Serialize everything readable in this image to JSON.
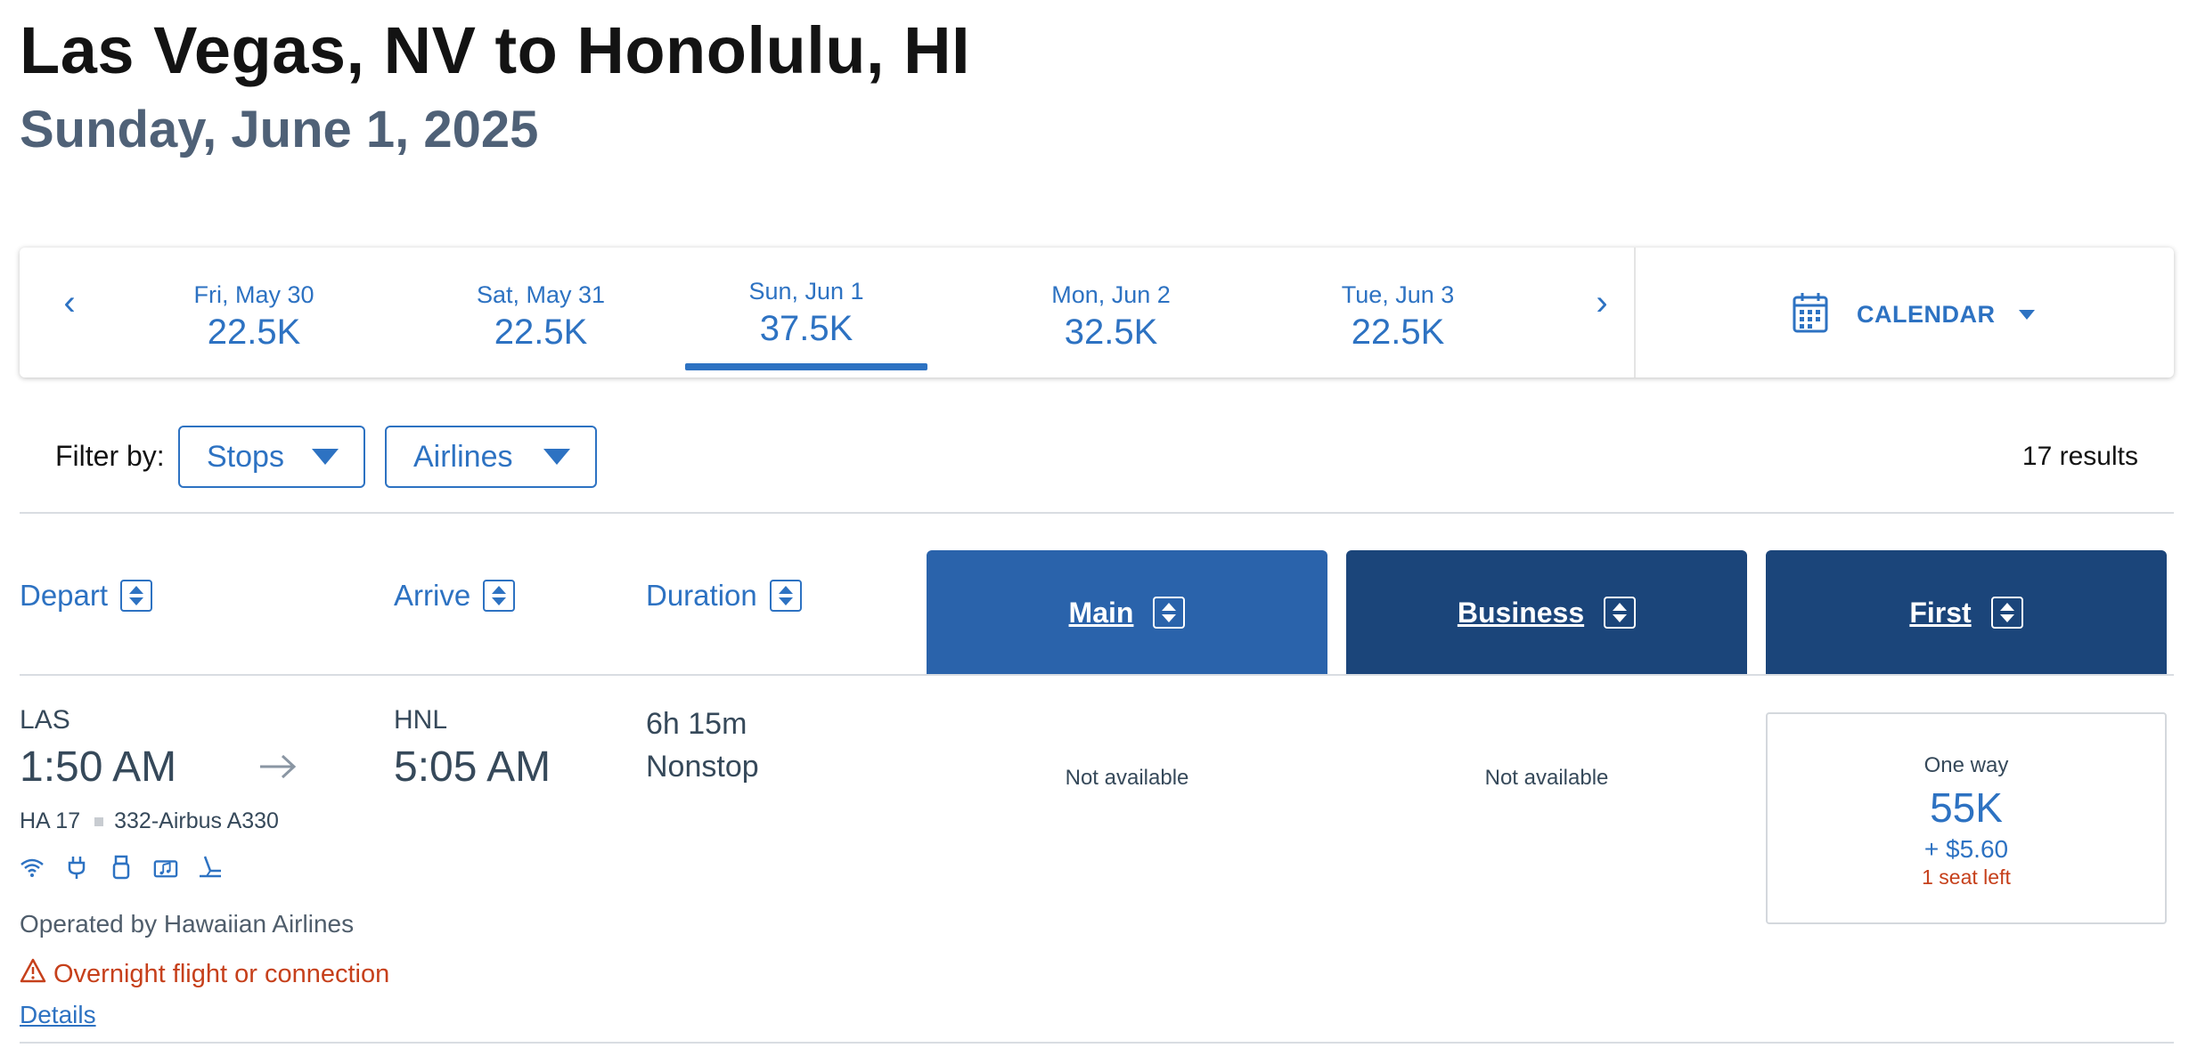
{
  "header": {
    "route": "Las Vegas, NV to Honolulu, HI",
    "date": "Sunday, June 1, 2025"
  },
  "date_bar": {
    "prev_icon": "chevron-left-icon",
    "next_icon": "chevron-right-icon",
    "days": [
      {
        "label": "Fri, May 30",
        "price": "22.5K",
        "selected": false
      },
      {
        "label": "Sat, May 31",
        "price": "22.5K",
        "selected": false
      },
      {
        "label": "Sun, Jun 1",
        "price": "37.5K",
        "selected": true
      },
      {
        "label": "Mon, Jun 2",
        "price": "32.5K",
        "selected": false
      },
      {
        "label": "Tue, Jun 3",
        "price": "22.5K",
        "selected": false
      }
    ],
    "calendar_label": "CALENDAR"
  },
  "filters": {
    "label": "Filter by:",
    "stops": "Stops",
    "airlines": "Airlines",
    "results": "17 results"
  },
  "columns": {
    "depart": "Depart",
    "arrive": "Arrive",
    "duration": "Duration",
    "main": "Main",
    "business": "Business",
    "first": "First"
  },
  "flight": {
    "origin": "LAS",
    "depart_time": "1:50 AM",
    "destination": "HNL",
    "arrive_time": "5:05 AM",
    "duration": "6h 15m",
    "stops": "Nonstop",
    "flight_number": "HA 17",
    "aircraft": "332-Airbus A330",
    "amenities": [
      "wifi-icon",
      "power-plug-icon",
      "usb-icon",
      "entertainment-icon",
      "seat-icon"
    ],
    "operator": "Operated by Hawaiian Airlines",
    "main_fare": "Not available",
    "business_fare": "Not available",
    "first_fare": {
      "label": "One way",
      "miles": "55K",
      "fee": "+ $5.60",
      "seats": "1 seat left"
    },
    "warning": "Overnight flight or connection",
    "details_link": "Details"
  },
  "colors": {
    "accent": "#2d72c2",
    "main_header": "#2a63ab",
    "premium_header": "#1b457a",
    "warning": "#c6401b"
  }
}
